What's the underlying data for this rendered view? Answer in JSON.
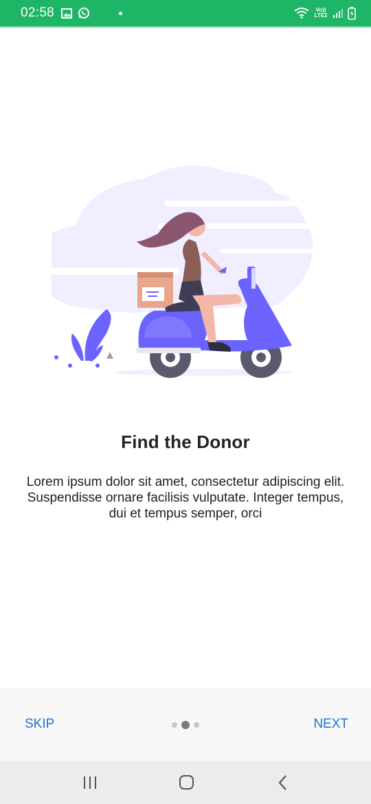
{
  "status_bar": {
    "time": "02:58",
    "network_label": "Vo)) LTE2",
    "icons": [
      "image-icon",
      "whatsapp-icon",
      "notification-dot",
      "wifi-icon",
      "signal-icon",
      "battery-icon"
    ]
  },
  "onboarding": {
    "illustration": "woman-on-scooter-delivery-illustration",
    "title": "Find the Donor",
    "description": "Lorem ipsum dolor sit amet, consectetur adipiscing elit. Suspendisse ornare facilisis vulputate. Integer tempus, dui et tempus semper, orci",
    "page_count": 3,
    "active_page": 2
  },
  "actions": {
    "skip_label": "SKIP",
    "next_label": "NEXT"
  },
  "colors": {
    "status_bar": "#1fb566",
    "accent": "#1976d2",
    "illustration_primary": "#6c63ff"
  },
  "nav_bar": {
    "buttons": [
      "recents-icon",
      "home-icon",
      "back-icon"
    ]
  }
}
